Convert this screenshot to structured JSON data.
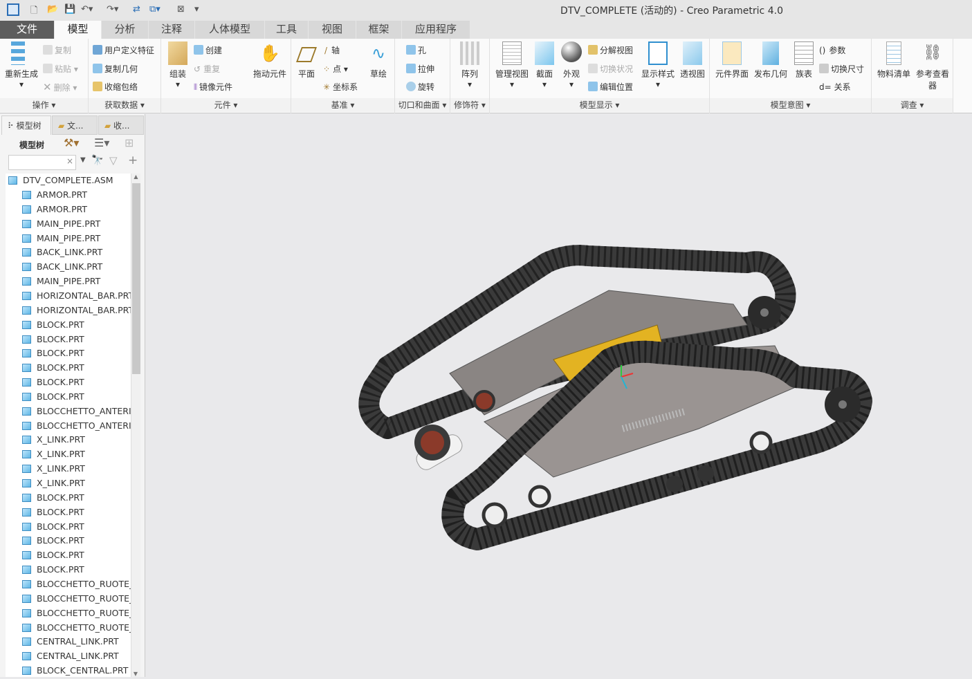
{
  "window": {
    "title": "DTV_COMPLETE (活动的) - Creo Parametric 4.0"
  },
  "quick_access": [
    "app-icon",
    "new-icon",
    "open-icon",
    "save-icon",
    "undo-icon",
    "redo-icon",
    "regenerate-icon",
    "windows-icon",
    "close-window-icon",
    "customize-icon"
  ],
  "tabs": [
    {
      "label": "文件"
    },
    {
      "label": "模型"
    },
    {
      "label": "分析"
    },
    {
      "label": "注释"
    },
    {
      "label": "人体模型"
    },
    {
      "label": "工具"
    },
    {
      "label": "视图"
    },
    {
      "label": "框架"
    },
    {
      "label": "应用程序"
    }
  ],
  "ribbon": {
    "operations": {
      "label": "操作",
      "regenerate": "重新生成",
      "copy": "复制",
      "paste": "粘贴",
      "delete": "删除"
    },
    "get_data": {
      "label": "获取数据",
      "udf": "用户定义特征",
      "copy_geom": "复制几何",
      "shrinkwrap": "收缩包络"
    },
    "component": {
      "label": "元件",
      "assemble": "组装",
      "create": "创建",
      "repeat": "重复",
      "mirror": "镜像元件",
      "drag": "拖动元件"
    },
    "datum": {
      "label": "基准",
      "plane": "平面",
      "axis": "轴",
      "point": "点",
      "csys": "坐标系",
      "sketch": "草绘"
    },
    "cut_surface": {
      "label": "切口和曲面",
      "hole": "孔",
      "extrude": "拉伸",
      "revolve": "旋转"
    },
    "modifiers": {
      "label": "修饰符",
      "pattern": "阵列"
    },
    "model_display": {
      "label": "模型显示",
      "manage_views": "管理视图",
      "section": "截面",
      "appearance": "外观",
      "explode": "分解视图",
      "toggle_status": "切换状况",
      "edit_position": "编辑位置",
      "display_style": "显示样式",
      "perspective": "透视图"
    },
    "model_intent": {
      "label": "模型意图",
      "comp_interface": "元件界面",
      "publish_geom": "发布几何",
      "family_table": "族表",
      "parameters": "参数",
      "switch_dims": "切换尺寸",
      "relations": "关系"
    },
    "investigate": {
      "label": "调查",
      "bom": "物料清单",
      "ref_viewer": "参考查看器"
    }
  },
  "left_panel": {
    "tabs": [
      {
        "label": "模型树"
      },
      {
        "label": "文..."
      },
      {
        "label": "收..."
      }
    ],
    "tree_label": "模型树",
    "search": {
      "value": "",
      "placeholder": ""
    },
    "root": "DTV_COMPLETE.ASM",
    "items": [
      "ARMOR.PRT",
      "ARMOR.PRT",
      "MAIN_PIPE.PRT",
      "MAIN_PIPE.PRT",
      "BACK_LINK.PRT",
      "BACK_LINK.PRT",
      "MAIN_PIPE.PRT",
      "HORIZONTAL_BAR.PRT",
      "HORIZONTAL_BAR.PRT",
      "BLOCK.PRT",
      "BLOCK.PRT",
      "BLOCK.PRT",
      "BLOCK.PRT",
      "BLOCK.PRT",
      "BLOCK.PRT",
      "BLOCCHETTO_ANTERIO",
      "BLOCCHETTO_ANTERIO",
      "X_LINK.PRT",
      "X_LINK.PRT",
      "X_LINK.PRT",
      "X_LINK.PRT",
      "BLOCK.PRT",
      "BLOCK.PRT",
      "BLOCK.PRT",
      "BLOCK.PRT",
      "BLOCK.PRT",
      "BLOCK.PRT",
      "BLOCCHETTO_RUOTE_T",
      "BLOCCHETTO_RUOTE_T",
      "BLOCCHETTO_RUOTE_T",
      "BLOCCHETTO_RUOTE_T",
      "CENTRAL_LINK.PRT",
      "CENTRAL_LINK.PRT",
      "BLOCK_CENTRAL.PRT"
    ]
  },
  "colors": {
    "file_tab": "#5d5d5d",
    "track": "#3a3a3a",
    "frame": "#8a8583",
    "motor": "#e3b322",
    "hub": "#8b3a2a"
  }
}
